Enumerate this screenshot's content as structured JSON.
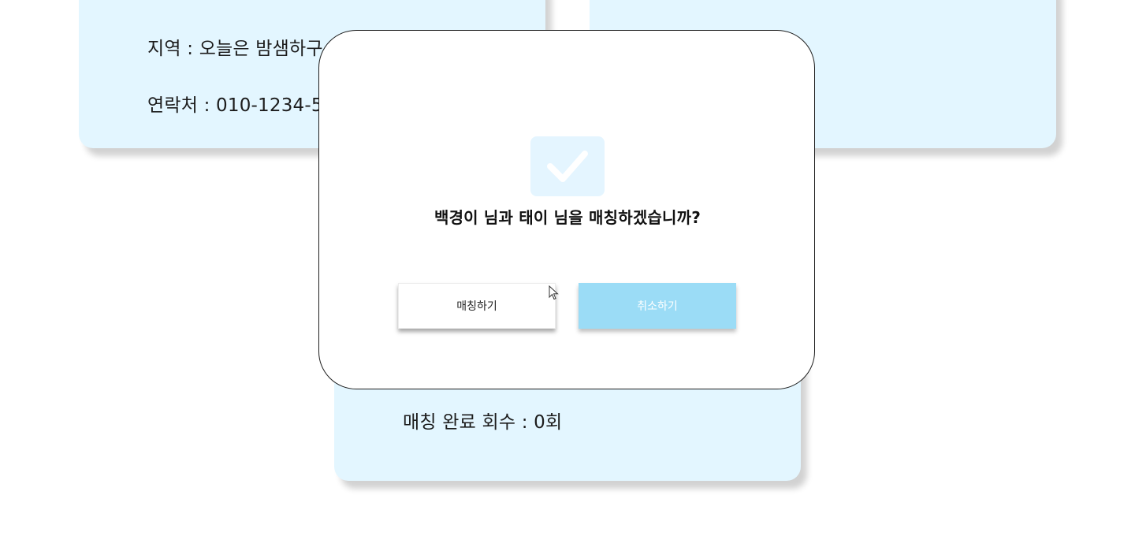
{
  "cards": {
    "left": {
      "region": "지역 : 오늘은 밤샘하구",
      "contact": "연락처 : 010-1234-5"
    },
    "bottom": {
      "match_count": "매칭 완료 회수 : 0회"
    }
  },
  "modal": {
    "icon": "check-icon",
    "message": "백경이 님과 태이 님을 매칭하겠습니까?",
    "confirm_label": "매칭하기",
    "cancel_label": "취소하기"
  },
  "colors": {
    "card_bg": "#e3f6ff",
    "check_bg": "#e4f5ff",
    "cancel_bg": "#9bdcf6"
  }
}
